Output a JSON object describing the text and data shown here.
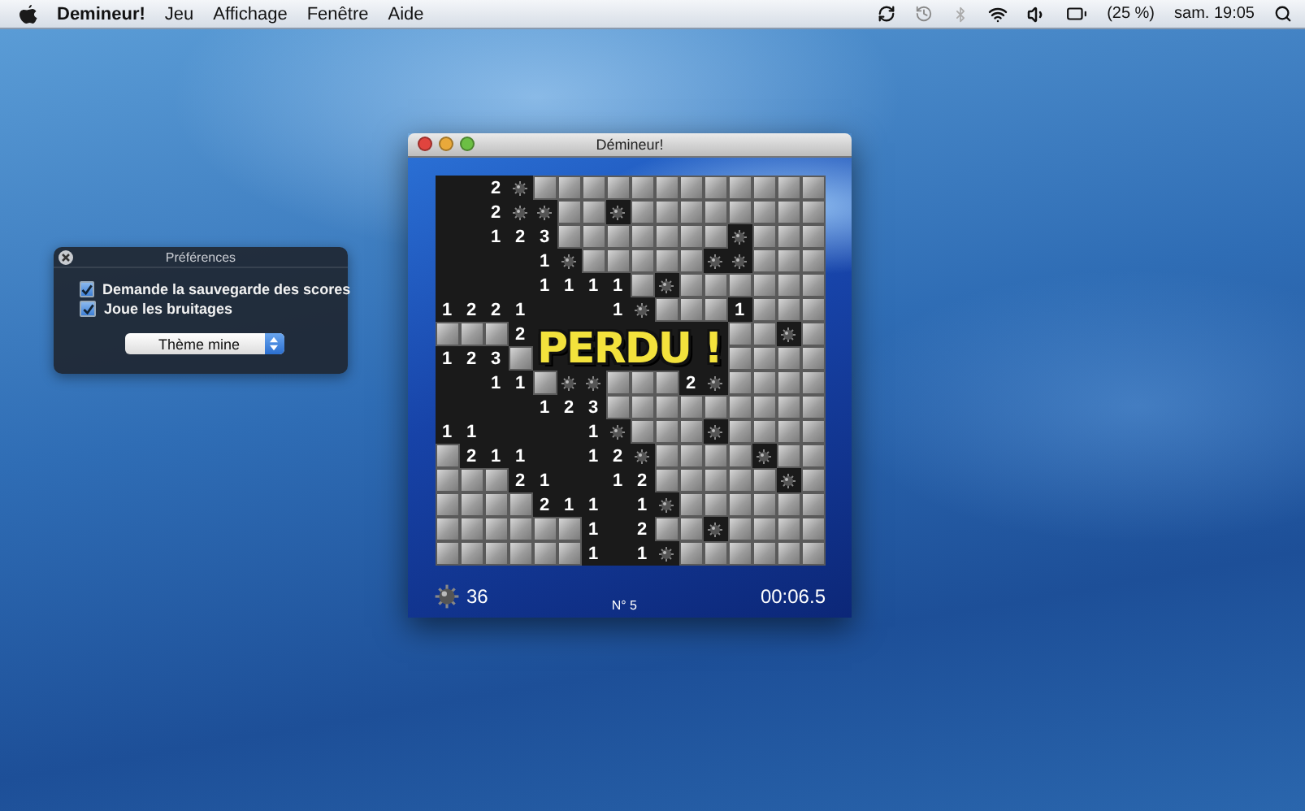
{
  "menu_bar": {
    "app_name": "Demineur!",
    "menus": [
      "Jeu",
      "Affichage",
      "Fenêtre",
      "Aide"
    ],
    "battery": "(25 %)",
    "clock": "sam. 19:05"
  },
  "preferences": {
    "title": "Préférences",
    "options": [
      {
        "label": "Demande la sauvegarde des scores",
        "checked": true
      },
      {
        "label": "Joue les bruitages",
        "checked": true
      }
    ],
    "theme": "Thème mine"
  },
  "game_window": {
    "title": "Démineur!",
    "overlay": "PERDU !",
    "mine_count": "36",
    "game_number": "N° 5",
    "timer": "00:06.5",
    "grid": [
      [
        {
          "kind": "empty"
        },
        {
          "kind": "empty"
        },
        {
          "kind": "number",
          "text": "2"
        },
        {
          "kind": "mine"
        },
        {
          "kind": "covered"
        },
        {
          "kind": "covered"
        },
        {
          "kind": "covered"
        },
        {
          "kind": "covered"
        },
        {
          "kind": "covered"
        },
        {
          "kind": "covered"
        },
        {
          "kind": "covered"
        },
        {
          "kind": "covered"
        },
        {
          "kind": "covered"
        },
        {
          "kind": "covered"
        },
        {
          "kind": "covered"
        },
        {
          "kind": "covered"
        }
      ],
      [
        {
          "kind": "empty"
        },
        {
          "kind": "empty"
        },
        {
          "kind": "number",
          "text": "2"
        },
        {
          "kind": "mine"
        },
        {
          "kind": "mine"
        },
        {
          "kind": "covered"
        },
        {
          "kind": "covered"
        },
        {
          "kind": "mine"
        },
        {
          "kind": "covered"
        },
        {
          "kind": "covered"
        },
        {
          "kind": "covered"
        },
        {
          "kind": "covered"
        },
        {
          "kind": "covered"
        },
        {
          "kind": "covered"
        },
        {
          "kind": "covered"
        },
        {
          "kind": "covered"
        }
      ],
      [
        {
          "kind": "empty"
        },
        {
          "kind": "empty"
        },
        {
          "kind": "number",
          "text": "1"
        },
        {
          "kind": "number",
          "text": "2"
        },
        {
          "kind": "number",
          "text": "3"
        },
        {
          "kind": "covered"
        },
        {
          "kind": "covered"
        },
        {
          "kind": "covered"
        },
        {
          "kind": "covered"
        },
        {
          "kind": "covered"
        },
        {
          "kind": "covered"
        },
        {
          "kind": "covered"
        },
        {
          "kind": "mine"
        },
        {
          "kind": "covered"
        },
        {
          "kind": "covered"
        },
        {
          "kind": "covered"
        }
      ],
      [
        {
          "kind": "empty"
        },
        {
          "kind": "empty"
        },
        {
          "kind": "empty"
        },
        {
          "kind": "empty"
        },
        {
          "kind": "number",
          "text": "1"
        },
        {
          "kind": "mine"
        },
        {
          "kind": "covered"
        },
        {
          "kind": "covered"
        },
        {
          "kind": "covered"
        },
        {
          "kind": "covered"
        },
        {
          "kind": "covered"
        },
        {
          "kind": "mine"
        },
        {
          "kind": "mine"
        },
        {
          "kind": "covered"
        },
        {
          "kind": "covered"
        },
        {
          "kind": "covered"
        }
      ],
      [
        {
          "kind": "empty"
        },
        {
          "kind": "empty"
        },
        {
          "kind": "empty"
        },
        {
          "kind": "empty"
        },
        {
          "kind": "number",
          "text": "1"
        },
        {
          "kind": "number",
          "text": "1"
        },
        {
          "kind": "number",
          "text": "1"
        },
        {
          "kind": "number",
          "text": "1"
        },
        {
          "kind": "covered"
        },
        {
          "kind": "mine"
        },
        {
          "kind": "covered"
        },
        {
          "kind": "covered"
        },
        {
          "kind": "covered"
        },
        {
          "kind": "covered"
        },
        {
          "kind": "covered"
        },
        {
          "kind": "covered"
        }
      ],
      [
        {
          "kind": "number",
          "text": "1"
        },
        {
          "kind": "number",
          "text": "2"
        },
        {
          "kind": "number",
          "text": "2"
        },
        {
          "kind": "number",
          "text": "1"
        },
        {
          "kind": "empty"
        },
        {
          "kind": "empty"
        },
        {
          "kind": "empty"
        },
        {
          "kind": "number",
          "text": "1"
        },
        {
          "kind": "mine"
        },
        {
          "kind": "covered"
        },
        {
          "kind": "covered"
        },
        {
          "kind": "covered"
        },
        {
          "kind": "number",
          "text": "1"
        },
        {
          "kind": "covered"
        },
        {
          "kind": "covered"
        },
        {
          "kind": "covered"
        }
      ],
      [
        {
          "kind": "covered"
        },
        {
          "kind": "covered"
        },
        {
          "kind": "covered"
        },
        {
          "kind": "number",
          "text": "2"
        },
        {
          "kind": "empty"
        },
        {
          "kind": "empty"
        },
        {
          "kind": "empty"
        },
        {
          "kind": "empty"
        },
        {
          "kind": "empty"
        },
        {
          "kind": "empty"
        },
        {
          "kind": "empty"
        },
        {
          "kind": "empty"
        },
        {
          "kind": "covered"
        },
        {
          "kind": "covered"
        },
        {
          "kind": "mine"
        },
        {
          "kind": "covered"
        }
      ],
      [
        {
          "kind": "number",
          "text": "1"
        },
        {
          "kind": "number",
          "text": "2"
        },
        {
          "kind": "number",
          "text": "3"
        },
        {
          "kind": "covered"
        },
        {
          "kind": "empty"
        },
        {
          "kind": "empty"
        },
        {
          "kind": "empty"
        },
        {
          "kind": "empty"
        },
        {
          "kind": "empty"
        },
        {
          "kind": "empty"
        },
        {
          "kind": "empty"
        },
        {
          "kind": "empty"
        },
        {
          "kind": "covered"
        },
        {
          "kind": "covered"
        },
        {
          "kind": "covered"
        },
        {
          "kind": "covered"
        }
      ],
      [
        {
          "kind": "empty"
        },
        {
          "kind": "empty"
        },
        {
          "kind": "number",
          "text": "1"
        },
        {
          "kind": "number",
          "text": "1"
        },
        {
          "kind": "covered"
        },
        {
          "kind": "mine"
        },
        {
          "kind": "mine"
        },
        {
          "kind": "covered"
        },
        {
          "kind": "covered"
        },
        {
          "kind": "covered"
        },
        {
          "kind": "number",
          "text": "2"
        },
        {
          "kind": "mine"
        },
        {
          "kind": "covered"
        },
        {
          "kind": "covered"
        },
        {
          "kind": "covered"
        },
        {
          "kind": "covered"
        }
      ],
      [
        {
          "kind": "empty"
        },
        {
          "kind": "empty"
        },
        {
          "kind": "empty"
        },
        {
          "kind": "empty"
        },
        {
          "kind": "number",
          "text": "1"
        },
        {
          "kind": "number",
          "text": "2"
        },
        {
          "kind": "number",
          "text": "3"
        },
        {
          "kind": "covered"
        },
        {
          "kind": "covered"
        },
        {
          "kind": "covered"
        },
        {
          "kind": "covered"
        },
        {
          "kind": "covered"
        },
        {
          "kind": "covered"
        },
        {
          "kind": "covered"
        },
        {
          "kind": "covered"
        },
        {
          "kind": "covered"
        }
      ],
      [
        {
          "kind": "number",
          "text": "1"
        },
        {
          "kind": "number",
          "text": "1"
        },
        {
          "kind": "empty"
        },
        {
          "kind": "empty"
        },
        {
          "kind": "empty"
        },
        {
          "kind": "empty"
        },
        {
          "kind": "number",
          "text": "1"
        },
        {
          "kind": "mine"
        },
        {
          "kind": "covered"
        },
        {
          "kind": "covered"
        },
        {
          "kind": "covered"
        },
        {
          "kind": "mine"
        },
        {
          "kind": "covered"
        },
        {
          "kind": "covered"
        },
        {
          "kind": "covered"
        },
        {
          "kind": "covered"
        }
      ],
      [
        {
          "kind": "covered"
        },
        {
          "kind": "number",
          "text": "2"
        },
        {
          "kind": "number",
          "text": "1"
        },
        {
          "kind": "number",
          "text": "1"
        },
        {
          "kind": "empty"
        },
        {
          "kind": "empty"
        },
        {
          "kind": "number",
          "text": "1"
        },
        {
          "kind": "number",
          "text": "2"
        },
        {
          "kind": "mine"
        },
        {
          "kind": "covered"
        },
        {
          "kind": "covered"
        },
        {
          "kind": "covered"
        },
        {
          "kind": "covered"
        },
        {
          "kind": "mine"
        },
        {
          "kind": "covered"
        },
        {
          "kind": "covered"
        }
      ],
      [
        {
          "kind": "covered"
        },
        {
          "kind": "covered"
        },
        {
          "kind": "covered"
        },
        {
          "kind": "number",
          "text": "2"
        },
        {
          "kind": "number",
          "text": "1"
        },
        {
          "kind": "empty"
        },
        {
          "kind": "empty"
        },
        {
          "kind": "number",
          "text": "1"
        },
        {
          "kind": "number",
          "text": "2"
        },
        {
          "kind": "covered"
        },
        {
          "kind": "covered"
        },
        {
          "kind": "covered"
        },
        {
          "kind": "covered"
        },
        {
          "kind": "covered"
        },
        {
          "kind": "mine"
        },
        {
          "kind": "covered"
        }
      ],
      [
        {
          "kind": "covered"
        },
        {
          "kind": "covered"
        },
        {
          "kind": "covered"
        },
        {
          "kind": "covered"
        },
        {
          "kind": "number",
          "text": "2"
        },
        {
          "kind": "number",
          "text": "1"
        },
        {
          "kind": "number",
          "text": "1"
        },
        {
          "kind": "empty"
        },
        {
          "kind": "number",
          "text": "1"
        },
        {
          "kind": "mine"
        },
        {
          "kind": "covered"
        },
        {
          "kind": "covered"
        },
        {
          "kind": "covered"
        },
        {
          "kind": "covered"
        },
        {
          "kind": "covered"
        },
        {
          "kind": "covered"
        }
      ],
      [
        {
          "kind": "covered"
        },
        {
          "kind": "covered"
        },
        {
          "kind": "covered"
        },
        {
          "kind": "covered"
        },
        {
          "kind": "covered"
        },
        {
          "kind": "covered"
        },
        {
          "kind": "number",
          "text": "1"
        },
        {
          "kind": "empty"
        },
        {
          "kind": "number",
          "text": "2"
        },
        {
          "kind": "covered"
        },
        {
          "kind": "covered"
        },
        {
          "kind": "mine"
        },
        {
          "kind": "covered"
        },
        {
          "kind": "covered"
        },
        {
          "kind": "covered"
        },
        {
          "kind": "covered"
        }
      ],
      [
        {
          "kind": "covered"
        },
        {
          "kind": "covered"
        },
        {
          "kind": "covered"
        },
        {
          "kind": "covered"
        },
        {
          "kind": "covered"
        },
        {
          "kind": "covered"
        },
        {
          "kind": "number",
          "text": "1"
        },
        {
          "kind": "empty"
        },
        {
          "kind": "number",
          "text": "1"
        },
        {
          "kind": "mine"
        },
        {
          "kind": "covered"
        },
        {
          "kind": "covered"
        },
        {
          "kind": "covered"
        },
        {
          "kind": "covered"
        },
        {
          "kind": "covered"
        },
        {
          "kind": "covered"
        }
      ]
    ]
  }
}
